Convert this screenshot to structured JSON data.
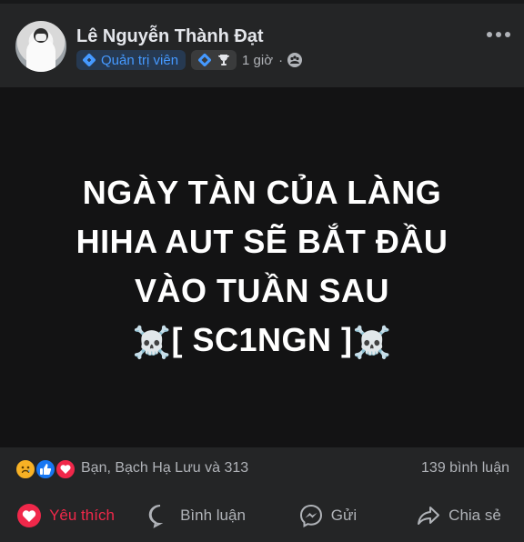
{
  "post": {
    "author": "Lê Nguyễn Thành Đạt",
    "role_badge": "Quản trị viên",
    "time": "1 giờ",
    "separator": "·",
    "text_lines": [
      "NGÀY TÀN CỦA LÀNG",
      "HIHA AUT SẼ BẮT ĐẦU",
      "VÀO TUẦN SAU"
    ],
    "emoji_line": {
      "left": "☠️",
      "text": "[ SC1NGN ]",
      "right": "☠️"
    }
  },
  "reactions": {
    "icons": [
      "sad-reaction",
      "like-reaction",
      "love-reaction"
    ],
    "summary": "Bạn, Bạch Hạ Lưu và 313",
    "comments": "139 bình luận"
  },
  "actions": {
    "like": "Yêu thích",
    "comment": "Bình luận",
    "send": "Gửi",
    "share": "Chia sẻ"
  },
  "colors": {
    "background": "#242526",
    "post_background": "#131314",
    "text_secondary": "#b0b3b8",
    "badge_blue": "#4599ff",
    "love_red": "#f0284a"
  }
}
